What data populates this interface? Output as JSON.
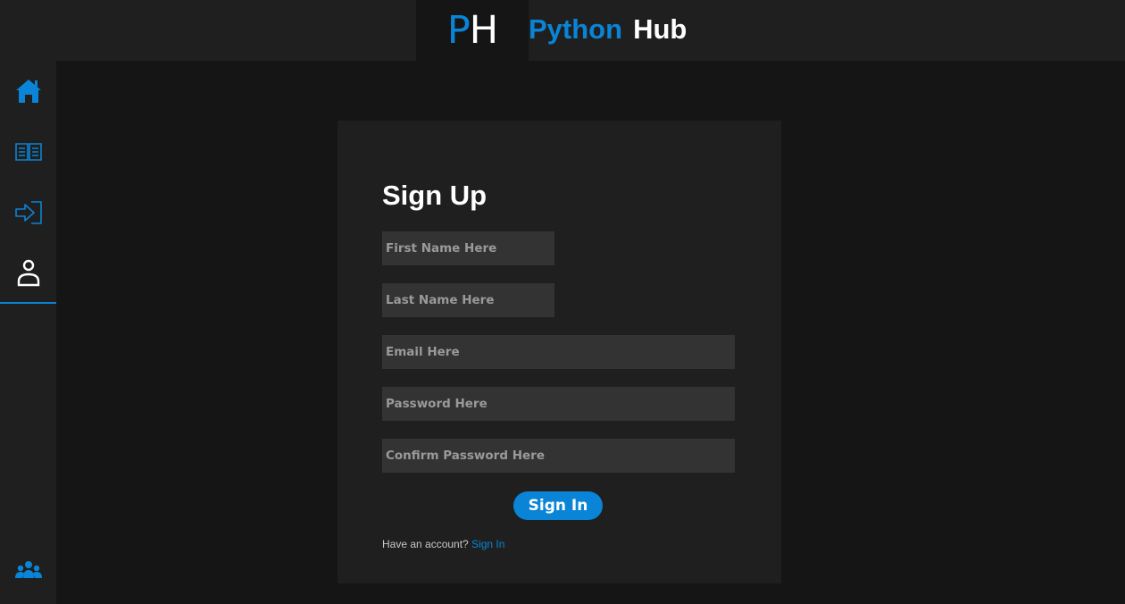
{
  "header": {
    "logo_letter_1": "P",
    "logo_letter_2": "H",
    "brand_part_1": "Python",
    "brand_part_2": "Hub"
  },
  "sidebar": {
    "items": [
      {
        "name": "home",
        "icon": "home-icon",
        "active": false
      },
      {
        "name": "library",
        "icon": "book-icon",
        "active": false
      },
      {
        "name": "login",
        "icon": "login-arrow-icon",
        "active": false
      },
      {
        "name": "profile",
        "icon": "user-icon",
        "active": true
      },
      {
        "name": "community",
        "icon": "users-group-icon",
        "active": false
      }
    ]
  },
  "form": {
    "title": "Sign Up",
    "first_name_placeholder": "First Name Here",
    "last_name_placeholder": "Last Name Here",
    "email_placeholder": "Email Here",
    "password_placeholder": "Password Here",
    "confirm_password_placeholder": "Confirm Password Here",
    "submit_label": "Sign In",
    "footer_text": "Have an account?",
    "footer_link": "Sign In"
  },
  "colors": {
    "accent": "#0a84d6",
    "background": "#151515",
    "panel": "#1f1f1f",
    "input": "#333333"
  }
}
